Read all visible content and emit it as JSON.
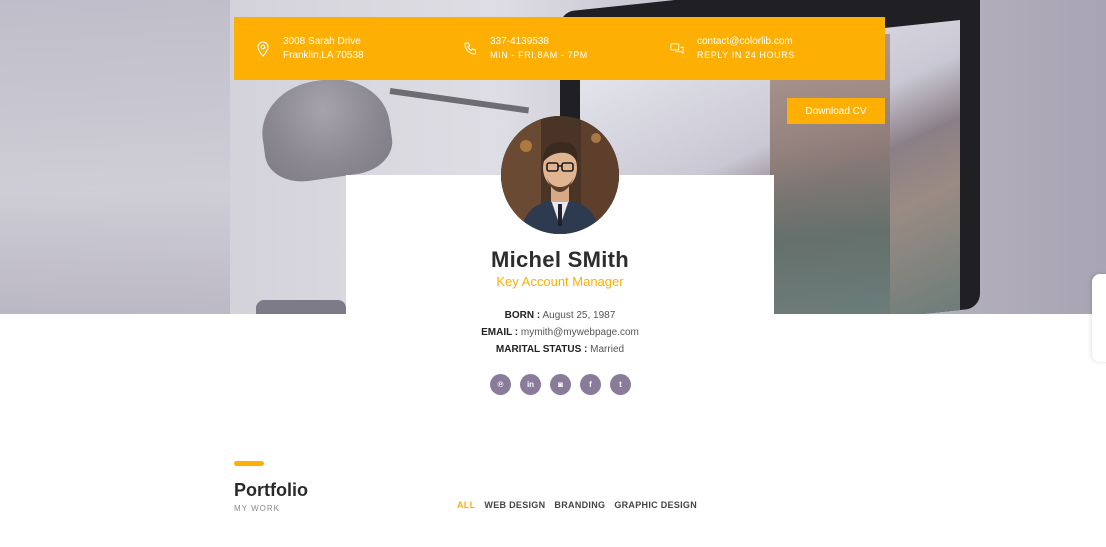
{
  "contact": {
    "address_line1": "3008 Sarah Drive",
    "address_line2": "Franklin,LA 70538",
    "phone_line1": "337-4139538",
    "phone_line2": "MIN - FRI,8AM - 7PM",
    "email_line1": "contact@colorlib.com",
    "email_line2": "REPLY IN 24 HOURS"
  },
  "download_label": "Download CV",
  "profile": {
    "name": "Michel SMith",
    "role": "Key Account Manager",
    "born_label": "BORN :",
    "born_value": " August 25, 1987",
    "email_label": "EMAIL :",
    "email_value": " mymith@mywebpage.com",
    "marital_label": "MARITAL STATUS :",
    "marital_value": " Married"
  },
  "socials": [
    {
      "name": "pinterest",
      "glyph": "℗"
    },
    {
      "name": "linkedin",
      "glyph": "in"
    },
    {
      "name": "instagram",
      "glyph": "◙"
    },
    {
      "name": "facebook",
      "glyph": "f"
    },
    {
      "name": "twitter",
      "glyph": "t"
    }
  ],
  "portfolio": {
    "title": "Portfolio",
    "subtitle": "MY WORK",
    "filters": [
      "ALL",
      "WEB DESIGN",
      "BRANDING",
      "GRAPHIC DESIGN"
    ]
  },
  "colors": {
    "accent": "#fdb003",
    "social": "#8a7b9b"
  }
}
